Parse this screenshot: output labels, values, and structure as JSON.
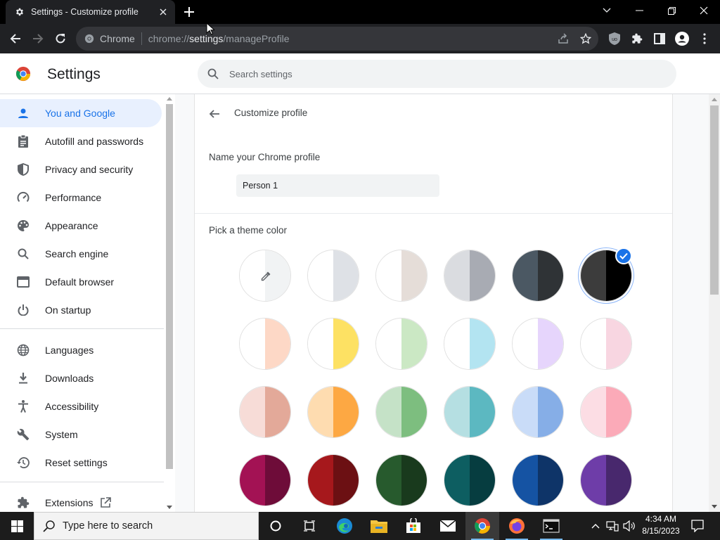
{
  "browser": {
    "tab_title": "Settings - Customize profile",
    "omnibox": {
      "chip": "Chrome",
      "url_prefix": "chrome://",
      "url_host": "settings",
      "url_path": "/manageProfile"
    }
  },
  "header": {
    "title": "Settings",
    "search_placeholder": "Search settings"
  },
  "sidebar": {
    "items": [
      {
        "label": "You and Google",
        "icon": "person-icon",
        "selected": true
      },
      {
        "label": "Autofill and passwords",
        "icon": "clipboard-icon"
      },
      {
        "label": "Privacy and security",
        "icon": "shield-icon"
      },
      {
        "label": "Performance",
        "icon": "speedometer-icon"
      },
      {
        "label": "Appearance",
        "icon": "palette-icon"
      },
      {
        "label": "Search engine",
        "icon": "search-icon"
      },
      {
        "label": "Default browser",
        "icon": "browser-window-icon"
      },
      {
        "label": "On startup",
        "icon": "power-icon"
      },
      {
        "label": "Languages",
        "icon": "globe-icon"
      },
      {
        "label": "Downloads",
        "icon": "download-icon"
      },
      {
        "label": "Accessibility",
        "icon": "accessibility-icon"
      },
      {
        "label": "System",
        "icon": "wrench-icon"
      },
      {
        "label": "Reset settings",
        "icon": "history-icon"
      },
      {
        "label": "Extensions",
        "icon": "puzzle-icon"
      }
    ]
  },
  "main": {
    "title": "Customize profile",
    "name_label": "Name your Chrome profile",
    "name_value": "Person 1",
    "theme_label": "Pick a theme color",
    "swatches": [
      {
        "left": "#ffffff",
        "right": "#f1f3f4",
        "picker": true
      },
      {
        "left": "#ffffff",
        "right": "#dee1e6"
      },
      {
        "left": "#ffffff",
        "right": "#e5ddd8"
      },
      {
        "left": "#dadce0",
        "right": "#a8abb3"
      },
      {
        "left": "#4b5863",
        "right": "#2f3336"
      },
      {
        "left": "#3c3c3c",
        "right": "#000000",
        "selected": true
      },
      {
        "left": "#ffffff",
        "right": "#fdd8c6"
      },
      {
        "left": "#ffffff",
        "right": "#fde163"
      },
      {
        "left": "#ffffff",
        "right": "#cbe8c4"
      },
      {
        "left": "#ffffff",
        "right": "#b3e4f1"
      },
      {
        "left": "#ffffff",
        "right": "#e6d5fc"
      },
      {
        "left": "#ffffff",
        "right": "#f8d6e1"
      },
      {
        "left": "#f7dcd7",
        "right": "#e3a999"
      },
      {
        "left": "#fedcb0",
        "right": "#fda843"
      },
      {
        "left": "#c5e2c7",
        "right": "#7dbe7f"
      },
      {
        "left": "#b5dfe2",
        "right": "#5cb8c1"
      },
      {
        "left": "#c9dcf8",
        "right": "#86aee7"
      },
      {
        "left": "#fcdde4",
        "right": "#fbaab8"
      },
      {
        "left": "#a31254",
        "right": "#6e0c39"
      },
      {
        "left": "#a6181c",
        "right": "#6c1013"
      },
      {
        "left": "#275a2d",
        "right": "#193a1d"
      },
      {
        "left": "#0d5e61",
        "right": "#063d40"
      },
      {
        "left": "#1553a3",
        "right": "#0e3468"
      },
      {
        "left": "#6e3da8",
        "right": "#48286d"
      }
    ]
  },
  "taskbar": {
    "search_placeholder": "Type here to search",
    "time": "4:34 AM",
    "date": "8/15/2023"
  },
  "colors": {
    "accent": "#1a73e8",
    "selected_nav_bg": "#e8f0fe",
    "chrome_dark": "#202124"
  }
}
